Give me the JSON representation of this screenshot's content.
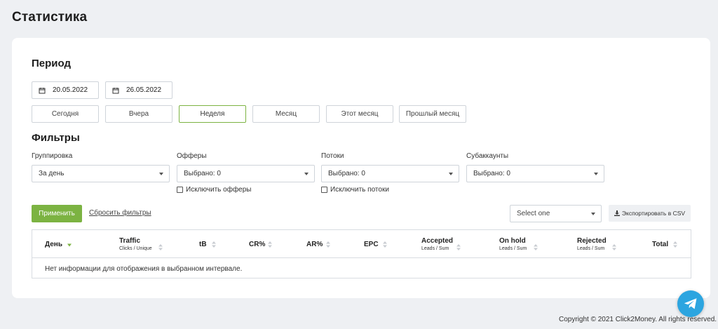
{
  "page": {
    "title": "Статистика"
  },
  "period": {
    "title": "Период",
    "date_from": "20.05.2022",
    "date_to": "26.05.2022",
    "buttons": [
      "Сегодня",
      "Вчера",
      "Неделя",
      "Месяц",
      "Этот месяц",
      "Прошлый месяц"
    ],
    "active": "Неделя"
  },
  "filters": {
    "title": "Фильтры",
    "grouping": {
      "label": "Группировка",
      "value": "За день"
    },
    "offers": {
      "label": "Офферы",
      "value": "Выбрано: 0",
      "exclude_label": "Исключить офферы"
    },
    "streams": {
      "label": "Потоки",
      "value": "Выбрано: 0",
      "exclude_label": "Исключить потоки"
    },
    "subaccounts": {
      "label": "Субаккаунты",
      "value": "Выбрано: 0"
    }
  },
  "actions": {
    "apply": "Применить",
    "reset": "Сбросить фильтры",
    "select_placeholder": "Select one",
    "export": "Экспортировать в CSV"
  },
  "table": {
    "columns": [
      {
        "label": "День",
        "sub": ""
      },
      {
        "label": "Traffic",
        "sub": "Clicks / Unique"
      },
      {
        "label": "tB",
        "sub": ""
      },
      {
        "label": "CR%",
        "sub": ""
      },
      {
        "label": "AR%",
        "sub": ""
      },
      {
        "label": "EPC",
        "sub": ""
      },
      {
        "label": "Accepted",
        "sub": "Leads / Sum"
      },
      {
        "label": "On hold",
        "sub": "Leads / Sum"
      },
      {
        "label": "Rejected",
        "sub": "Leads / Sum"
      },
      {
        "label": "Total",
        "sub": ""
      }
    ],
    "empty_message": "Нет информации для отображения в выбранном интервале."
  },
  "footer": {
    "copyright": "Copyright © 2021 Click2Money. All rights reserved."
  },
  "colors": {
    "accent": "#7cb342",
    "telegram": "#2ca5e0",
    "background": "#eef0f3"
  },
  "icons": [
    "calendar-icon",
    "caret-down-icon",
    "sort-icon",
    "download-icon",
    "telegram-icon"
  ]
}
